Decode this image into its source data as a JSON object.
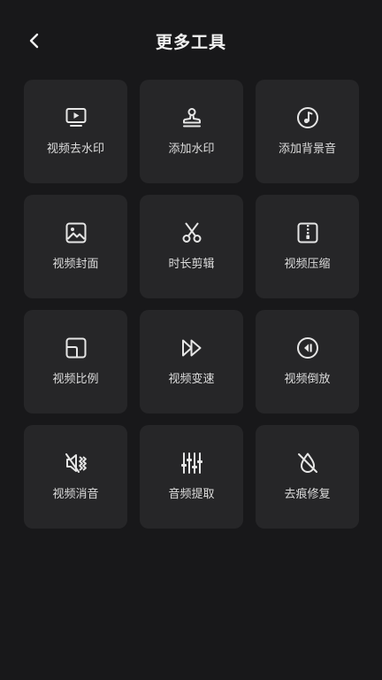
{
  "header": {
    "title": "更多工具"
  },
  "tools": [
    {
      "label": "视频去水印",
      "icon": "video-play-screen-icon"
    },
    {
      "label": "添加水印",
      "icon": "stamp-icon"
    },
    {
      "label": "添加背景音",
      "icon": "music-note-icon"
    },
    {
      "label": "视频封面",
      "icon": "image-icon"
    },
    {
      "label": "时长剪辑",
      "icon": "scissors-icon"
    },
    {
      "label": "视频压缩",
      "icon": "zip-file-icon"
    },
    {
      "label": "视频比例",
      "icon": "aspect-ratio-icon"
    },
    {
      "label": "视频变速",
      "icon": "fast-forward-icon"
    },
    {
      "label": "视频倒放",
      "icon": "rewind-icon"
    },
    {
      "label": "视频消音",
      "icon": "mute-icon"
    },
    {
      "label": "音频提取",
      "icon": "equalizer-icon"
    },
    {
      "label": "去痕修复",
      "icon": "drop-off-icon"
    }
  ]
}
